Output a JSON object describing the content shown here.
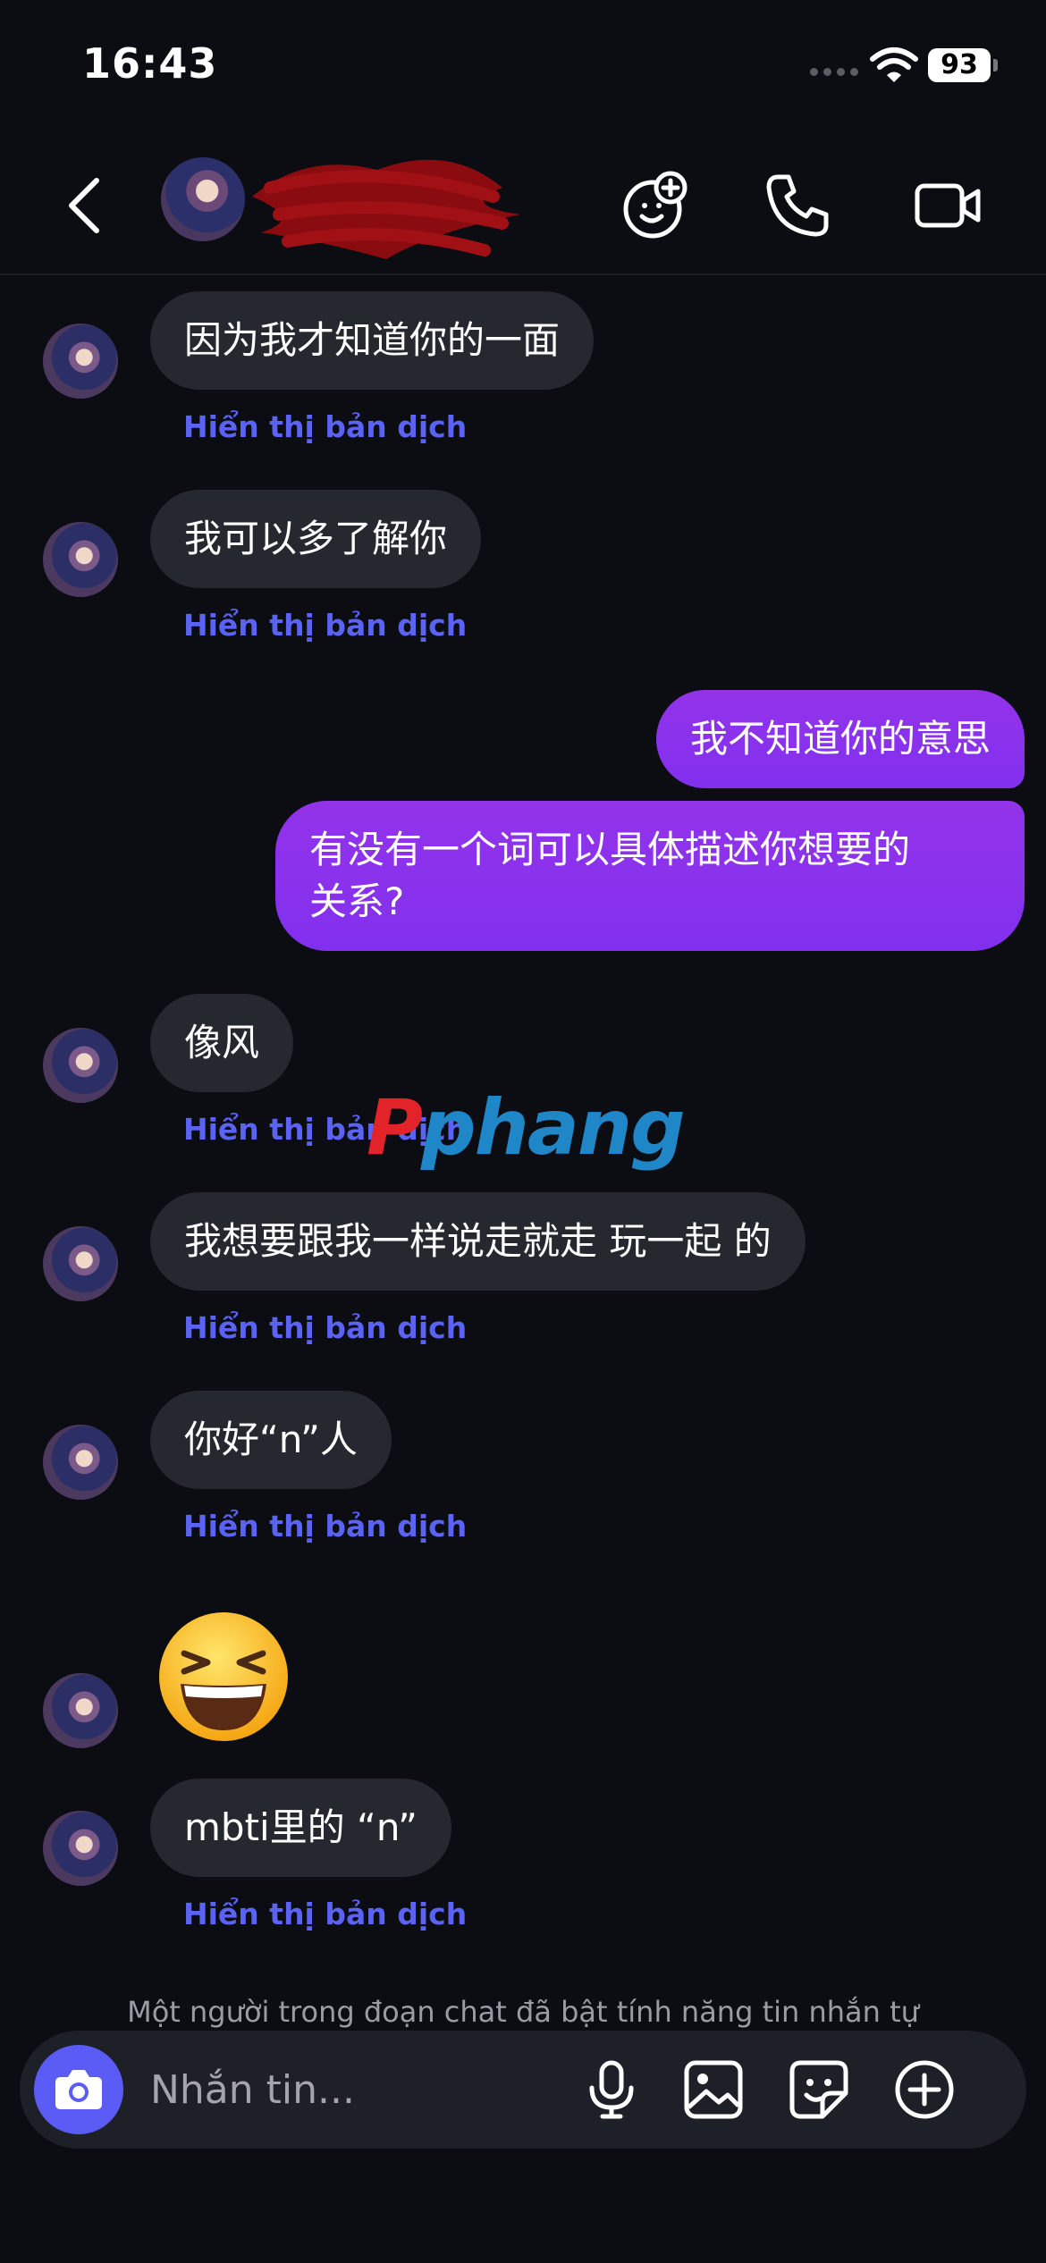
{
  "status_bar": {
    "time": "16:43",
    "battery": "93"
  },
  "messages": [
    {
      "text": "因为我才知道你的一面",
      "translate": "Hiển thị bản dịch"
    },
    {
      "text": "我可以多了解你",
      "translate": "Hiển thị bản dịch"
    },
    {
      "text": "我不知道你的意思"
    },
    {
      "line1": "有没有一个词可以具体描述你想要的",
      "line2": "关系?"
    },
    {
      "text": "像风",
      "translate": "Hiển thị bản dịch"
    },
    {
      "text": "我想要跟我一样说走就走 玩一起 的",
      "translate": "Hiển thị bản dịch"
    },
    {
      "text": "你好“n”人",
      "translate": "Hiển thị bản dịch"
    },
    {
      "emoji": "😆"
    },
    {
      "text": "mbti里的 “n”",
      "translate": "Hiển thị bản dịch"
    }
  ],
  "watermark": {
    "part1": "P",
    "part2": "phang"
  },
  "notice": "Một người trong đoạn chat đã bật tính năng tin nhắn tự",
  "composer": {
    "placeholder": "Nhắn tin..."
  },
  "colors": {
    "accent": "#5b5cf6",
    "outgoing_bubble": "#9333ea",
    "incoming_bubble": "#262830",
    "link": "#5b63f5"
  }
}
